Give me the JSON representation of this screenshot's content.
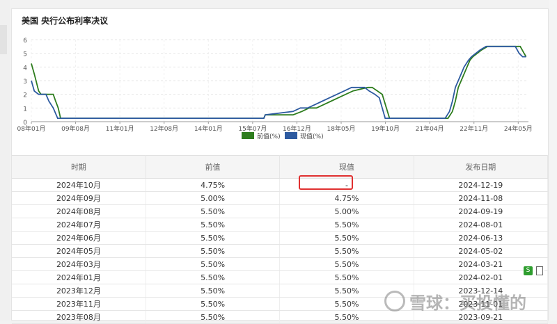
{
  "panel": {
    "title": "美国 央行公布利率决议"
  },
  "chart_data": {
    "type": "line",
    "title": "",
    "xlabel": "",
    "ylabel": "",
    "ylim": [
      0,
      6
    ],
    "yticks": [
      "0",
      "1",
      "2",
      "3",
      "4",
      "5",
      "6"
    ],
    "x_tick_labels": [
      "08年01月",
      "09年08月",
      "11年01月",
      "12年08月",
      "14年01月",
      "15年07月",
      "16年12月",
      "18年05月",
      "19年10月",
      "21年04月",
      "22年11月",
      "24年05月"
    ],
    "grid": true,
    "legend_position": "bottom",
    "series": [
      {
        "name": "前值(%)",
        "color": "#2e7d1e",
        "x": [
          2008.0,
          2008.1,
          2008.25,
          2008.33,
          2008.5,
          2008.75,
          2008.83,
          2008.92,
          2009.0,
          2015.95,
          2016.0,
          2016.95,
          2017.25,
          2017.5,
          2017.75,
          2018.0,
          2018.25,
          2018.5,
          2018.75,
          2019.0,
          2019.5,
          2019.66,
          2019.83,
          2020.0,
          2020.25,
          2022.25,
          2022.4,
          2022.5,
          2022.6,
          2022.75,
          2022.9,
          2023.0,
          2023.1,
          2023.25,
          2023.4,
          2023.6,
          2024.6,
          2024.72,
          2024.85,
          2024.92
        ],
        "values": [
          4.25,
          3.5,
          2.25,
          2.0,
          2.0,
          2.0,
          1.5,
          1.0,
          0.25,
          0.25,
          0.5,
          0.5,
          0.75,
          1.0,
          1.0,
          1.25,
          1.5,
          1.75,
          2.0,
          2.25,
          2.5,
          2.5,
          2.25,
          2.0,
          0.25,
          0.25,
          0.75,
          1.5,
          2.5,
          3.25,
          4.0,
          4.5,
          4.75,
          5.0,
          5.25,
          5.5,
          5.5,
          5.5,
          5.0,
          4.75
        ]
      },
      {
        "name": "现值(%)",
        "color": "#2d5aa0",
        "x": [
          2008.0,
          2008.1,
          2008.25,
          2008.33,
          2008.5,
          2008.6,
          2008.75,
          2008.9,
          2015.95,
          2016.0,
          2016.95,
          2017.2,
          2017.45,
          2017.7,
          2017.95,
          2018.2,
          2018.45,
          2018.7,
          2018.95,
          2019.4,
          2019.55,
          2019.75,
          2019.9,
          2020.1,
          2022.15,
          2022.3,
          2022.4,
          2022.5,
          2022.65,
          2022.8,
          2022.95,
          2023.05,
          2023.2,
          2023.35,
          2023.55,
          2024.55,
          2024.68,
          2024.8,
          2024.92
        ],
        "values": [
          3.0,
          2.25,
          2.0,
          2.0,
          2.0,
          1.5,
          1.0,
          0.25,
          0.25,
          0.5,
          0.75,
          1.0,
          1.0,
          1.25,
          1.5,
          1.75,
          2.0,
          2.25,
          2.5,
          2.5,
          2.25,
          2.0,
          1.75,
          0.25,
          0.25,
          0.75,
          1.5,
          2.5,
          3.25,
          4.0,
          4.5,
          4.75,
          5.0,
          5.25,
          5.5,
          5.5,
          5.0,
          4.75,
          4.75
        ]
      }
    ]
  },
  "table": {
    "columns": [
      "时期",
      "前值",
      "现值",
      "发布日期"
    ],
    "rows": [
      [
        "2024年10月",
        "4.75%",
        "-",
        "2024-12-19"
      ],
      [
        "2024年09月",
        "5.00%",
        "4.75%",
        "2024-11-08"
      ],
      [
        "2024年08月",
        "5.50%",
        "5.00%",
        "2024-09-19"
      ],
      [
        "2024年07月",
        "5.50%",
        "5.50%",
        "2024-08-01"
      ],
      [
        "2024年06月",
        "5.50%",
        "5.50%",
        "2024-06-13"
      ],
      [
        "2024年05月",
        "5.50%",
        "5.50%",
        "2024-05-02"
      ],
      [
        "2024年03月",
        "5.50%",
        "5.50%",
        "2024-03-21"
      ],
      [
        "2024年01月",
        "5.50%",
        "5.50%",
        "2024-02-01"
      ],
      [
        "2023年12月",
        "5.50%",
        "5.50%",
        "2023-12-14"
      ],
      [
        "2023年11月",
        "5.50%",
        "5.50%",
        "2023-11-01"
      ],
      [
        "2023年08月",
        "5.50%",
        "5.50%",
        "2023-09-21"
      ]
    ]
  },
  "watermark": {
    "text": "雪球：买投懂的"
  }
}
